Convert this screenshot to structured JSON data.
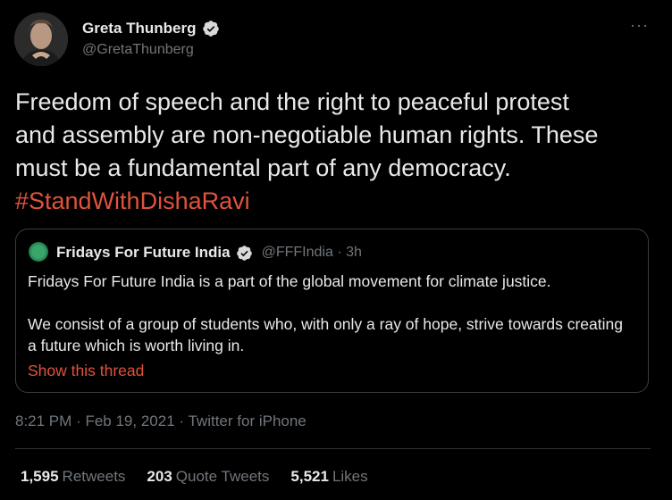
{
  "author": {
    "display_name": "Greta Thunberg",
    "handle": "@GretaThunberg",
    "verified_icon": "verified-badge-icon",
    "avatar_icon": "profile-photo"
  },
  "more_label": "···",
  "body": {
    "lines": [
      "Freedom of speech and the right to peaceful protest",
      "and assembly are non-negotiable human rights. These",
      "must be a fundamental part of any democracy."
    ],
    "hashtag": "#StandWithDishaRavi"
  },
  "quoted": {
    "display_name": "Fridays For Future India",
    "handle": "@FFFIndia",
    "separator": "·",
    "time": "3h",
    "paragraphs": [
      "Fridays For Future India is a part of the global movement for climate justice.",
      "We consist of a group of students who, with only a ray of hope, strive towards creating a future which is worth living in."
    ],
    "show_thread": "Show this thread"
  },
  "meta": {
    "time": "8:21 PM",
    "sep1": "·",
    "date": "Feb 19, 2021",
    "sep2": "·",
    "source": "Twitter for iPhone"
  },
  "stats": {
    "retweets_count": "1,595",
    "retweets_label": "Retweets",
    "quotes_count": "203",
    "quotes_label": "Quote Tweets",
    "likes_count": "5,521",
    "likes_label": "Likes"
  },
  "colors": {
    "background": "#000000",
    "text": "#e7e9ea",
    "muted": "#71767b",
    "accent": "#e0533c",
    "verified": "#d9d9d9"
  }
}
